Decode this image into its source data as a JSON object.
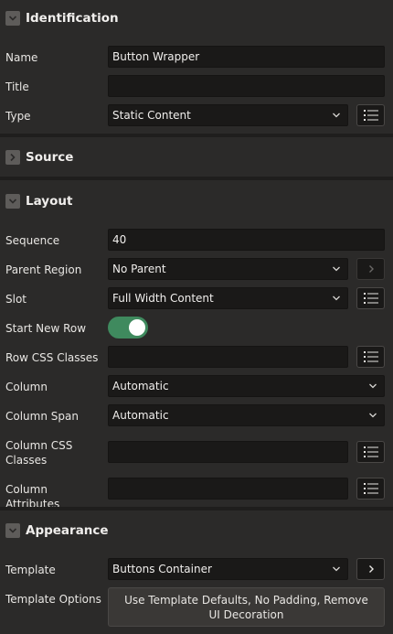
{
  "sections": {
    "identification": {
      "title": "Identification"
    },
    "source": {
      "title": "Source"
    },
    "layout": {
      "title": "Layout"
    },
    "appearance": {
      "title": "Appearance"
    }
  },
  "identification": {
    "name": {
      "label": "Name",
      "value": "Button Wrapper"
    },
    "title": {
      "label": "Title",
      "value": ""
    },
    "type": {
      "label": "Type",
      "value": "Static Content"
    }
  },
  "layout": {
    "sequence": {
      "label": "Sequence",
      "value": "40"
    },
    "parent_region": {
      "label": "Parent Region",
      "value": "No Parent"
    },
    "slot": {
      "label": "Slot",
      "value": "Full Width Content"
    },
    "start_new_row": {
      "label": "Start New Row",
      "value": true
    },
    "row_css_classes": {
      "label": "Row CSS Classes",
      "value": ""
    },
    "column": {
      "label": "Column",
      "value": "Automatic"
    },
    "column_span": {
      "label": "Column Span",
      "value": "Automatic"
    },
    "column_css_classes": {
      "label": "Column CSS Classes",
      "value": ""
    },
    "column_attributes": {
      "label": "Column Attributes",
      "value": ""
    }
  },
  "appearance": {
    "template": {
      "label": "Template",
      "value": "Buttons Container"
    },
    "template_options": {
      "label": "Template Options",
      "value": "Use Template Defaults, No Padding, Remove UI Decoration"
    }
  },
  "icons": {
    "section_expanded": "chevron-down-icon",
    "section_collapsed": "chevron-right-icon",
    "select": "chevron-down-icon",
    "list": "list-icon",
    "link": "chevron-right-icon"
  }
}
